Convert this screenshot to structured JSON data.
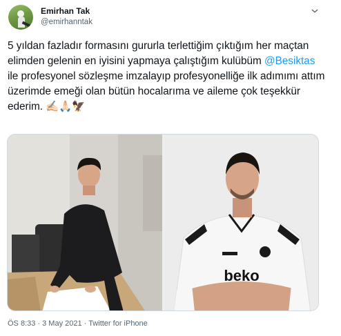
{
  "author": {
    "name": "Emirhan Tak",
    "handle": "@emirhanntak"
  },
  "tweet": {
    "text_before": "5 yıldan fazladır formasını gururla terlettiğim çıktığım her maçtan elimden gelenin en iyisini yapmaya çalıştığım kulübüm ",
    "mention": "@Besiktas",
    "text_after": " ile profesyonel sözleşme imzalayıp profesyonelliğe ilk adımımı attım üzerimde emeği olan bütün hocalarıma ve aileme çok teşekkür ederim. ✍🏻🙏🏻🦅"
  },
  "media": {
    "left_photo": "contract-signing-photo",
    "right_photo": "besiktas-jersey-portrait-photo",
    "jersey_text": "beko"
  },
  "meta": {
    "timestamp": "ÖS 8:33 · 3 May 2021 · Twitter for iPhone"
  },
  "icons": {
    "more": "more-options-icon"
  },
  "colors": {
    "link": "#1d9bf0",
    "text": "#0f1419",
    "secondary": "#536471"
  }
}
